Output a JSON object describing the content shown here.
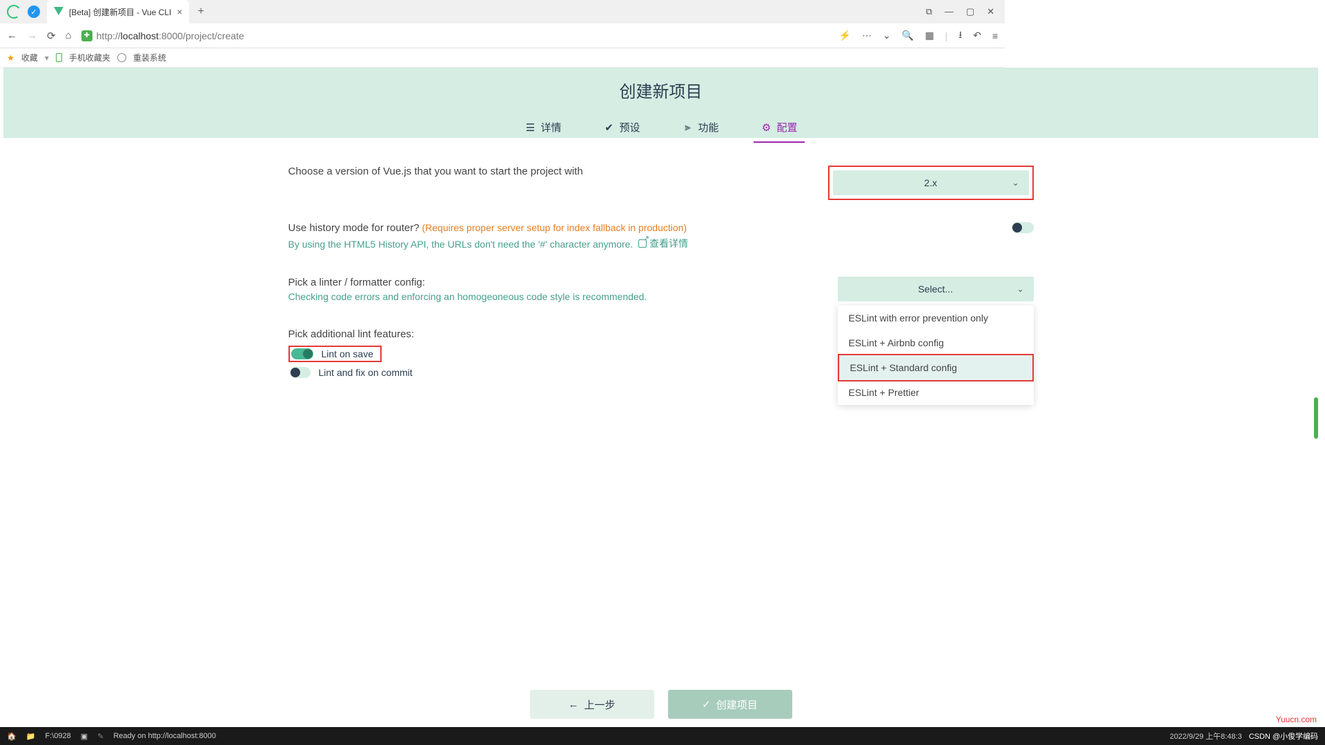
{
  "browser": {
    "tab_title": "[Beta] 创建新项目 - Vue CLI",
    "url_prefix": "http://",
    "url_host": "localhost",
    "url_port": ":8000",
    "url_path": "/project/create"
  },
  "bookmarks": {
    "fav": "收藏",
    "mobile": "手机收藏夹",
    "reinstall": "重装系统"
  },
  "page": {
    "title": "创建新项目",
    "tabs": [
      {
        "label": "详情"
      },
      {
        "label": "预设"
      },
      {
        "label": "功能"
      },
      {
        "label": "配置"
      }
    ]
  },
  "config": {
    "vue_version": {
      "label": "Choose a version of Vue.js that you want to start the project with",
      "selected": "2.x"
    },
    "history": {
      "label": "Use history mode for router?",
      "note": "(Requires proper server setup for index fallback in production)",
      "desc": "By using the HTML5 History API, the URLs don't need the '#' character anymore.",
      "link": "查看详情"
    },
    "linter": {
      "label": "Pick a linter / formatter config:",
      "desc": "Checking code errors and enforcing an homogeoneous code style is recommended.",
      "placeholder": "Select...",
      "options": [
        "ESLint with error prevention only",
        "ESLint + Airbnb config",
        "ESLint + Standard config",
        "ESLint + Prettier"
      ]
    },
    "lint_features": {
      "label": "Pick additional lint features:",
      "lint_on_save": "Lint on save",
      "lint_on_commit": "Lint and fix on commit"
    }
  },
  "buttons": {
    "back": "上一步",
    "create": "创建项目"
  },
  "taskbar": {
    "path": "F:\\0928",
    "ready": "Ready on http://localhost:8000",
    "time": "2022/9/29 上午8:48:3",
    "csdn": "CSDN @小俊学编码"
  },
  "watermark": "Yuucn.com"
}
